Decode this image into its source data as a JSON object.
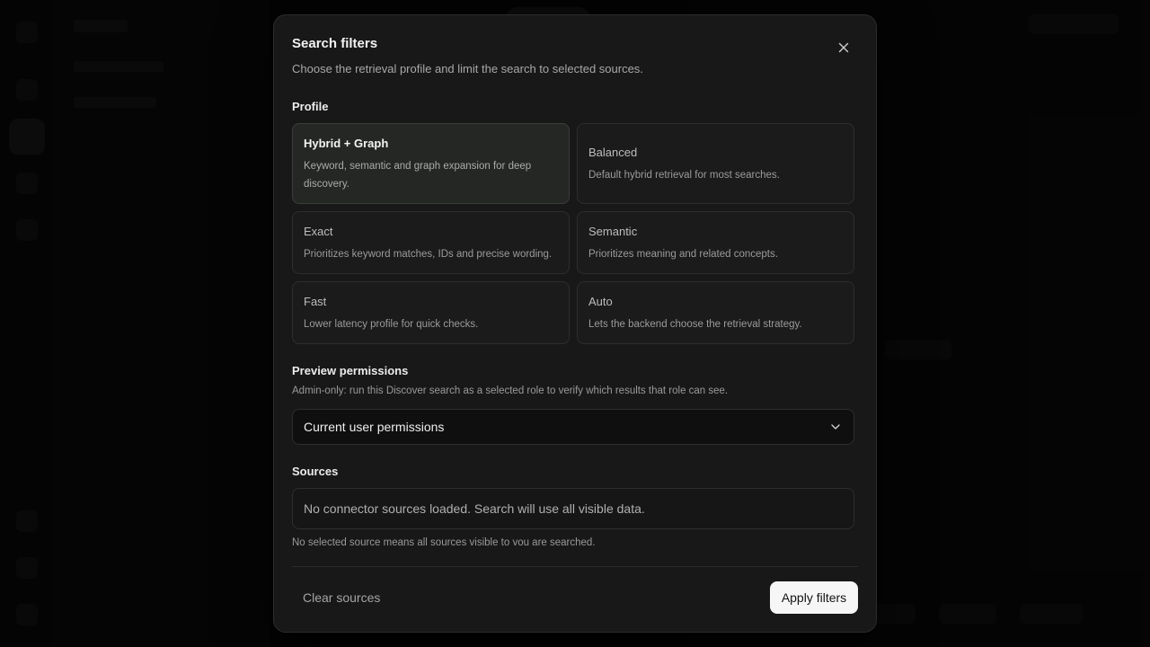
{
  "modal": {
    "title": "Search filters",
    "subtitle": "Choose the retrieval profile and limit the search to selected sources.",
    "close_icon": "close-icon"
  },
  "profile": {
    "label": "Profile",
    "selected": "Hybrid + Graph",
    "options": [
      {
        "title": "Hybrid + Graph",
        "description": "Keyword, semantic and graph expansion for deep discovery."
      },
      {
        "title": "Balanced",
        "description": "Default hybrid retrieval for most searches."
      },
      {
        "title": "Exact",
        "description": "Prioritizes keyword matches, IDs and precise wording."
      },
      {
        "title": "Semantic",
        "description": "Prioritizes meaning and related concepts."
      },
      {
        "title": "Fast",
        "description": "Lower latency profile for quick checks."
      },
      {
        "title": "Auto",
        "description": "Lets the backend choose the retrieval strategy."
      }
    ]
  },
  "preview_permissions": {
    "label": "Preview permissions",
    "hint": "Admin-only: run this Discover search as a selected role to verify which results that role can see.",
    "selected_value": "Current user permissions",
    "chevron_icon": "chevron-down-icon"
  },
  "sources": {
    "label": "Sources",
    "empty_message": "No connector sources loaded. Search will use all visible data.",
    "hint": "No selected source means all sources visible to you are searched."
  },
  "footer": {
    "clear_label": "Clear sources",
    "apply_label": "Apply filters"
  },
  "colors": {
    "modal_bg": "#181818",
    "selected_card_bg": "#252725",
    "primary_button_bg": "#f6f6f6"
  }
}
